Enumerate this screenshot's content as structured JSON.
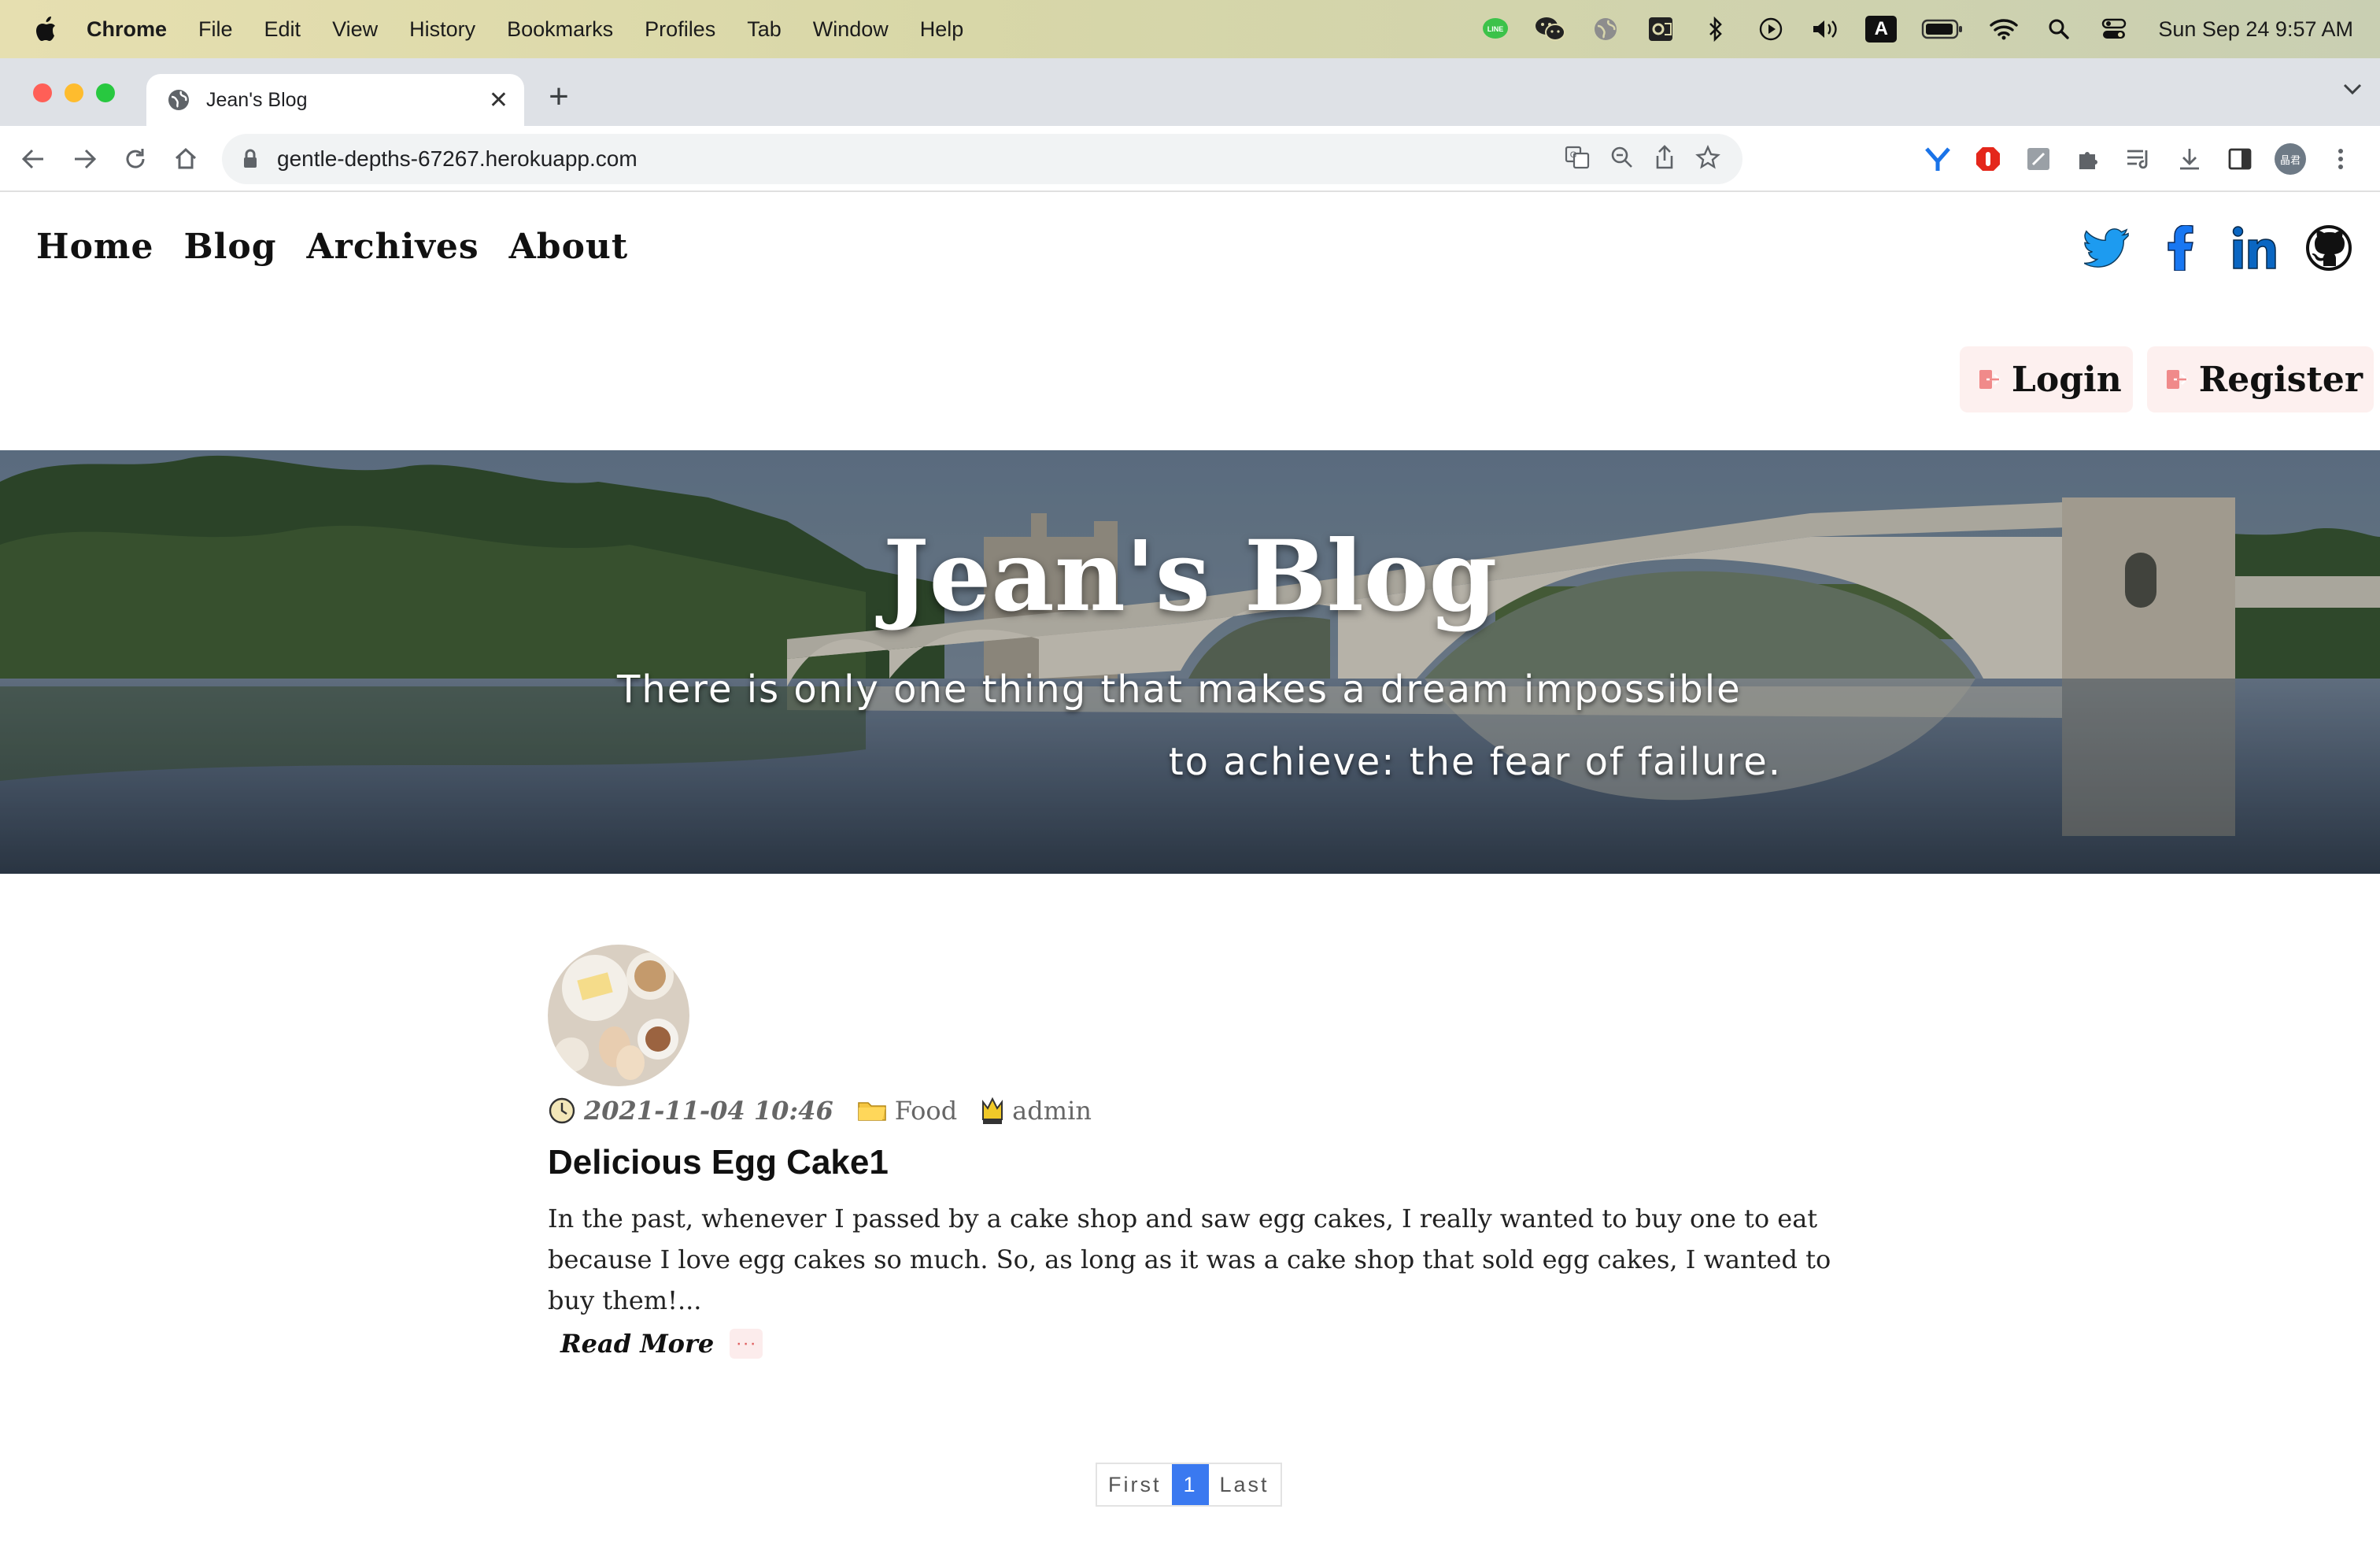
{
  "menubar": {
    "app": "Chrome",
    "items": [
      "File",
      "Edit",
      "View",
      "History",
      "Bookmarks",
      "Profiles",
      "Tab",
      "Window",
      "Help"
    ],
    "clock": "Sun Sep 24  9:57 AM",
    "status_icons": [
      "line-icon",
      "wechat-icon",
      "globe-icon",
      "outlook-icon",
      "bluetooth-icon",
      "play-icon",
      "volume-icon",
      "input-source-icon",
      "battery-icon",
      "wifi-icon",
      "spotlight-icon",
      "control-center-icon"
    ],
    "input_source": "A"
  },
  "browser": {
    "tab_title": "Jean's Blog",
    "url": "gentle-depths-67267.herokuapp.com",
    "profile_label": "晶君"
  },
  "site": {
    "nav": [
      "Home",
      "Blog",
      "Archives",
      "About"
    ],
    "social": [
      "twitter-icon",
      "facebook-icon",
      "linkedin-icon",
      "github-icon"
    ],
    "auth": {
      "login": "Login",
      "register": "Register"
    },
    "hero": {
      "title": "Jean's Blog",
      "subtitle_line1": "There is only one thing that makes a dream impossible",
      "subtitle_line2": "to achieve: the fear of failure."
    },
    "post": {
      "date": "2021-11-04 10:46",
      "category": "Food",
      "author": "admin",
      "title": "Delicious Egg Cake1",
      "excerpt": "In the past, whenever I passed by a cake shop and saw egg cakes, I really wanted to buy one to eat because I love egg cakes so much. So, as long as it was a cake shop that sold egg cakes, I wanted to buy them!...",
      "read_more": "Read More",
      "more_dots": "···"
    },
    "pager": {
      "first": "First",
      "current": "1",
      "last": "Last"
    }
  },
  "colors": {
    "accent": "#3a79f0",
    "auth_bg": "#fdf0ef",
    "twitter": "#1d9bf0"
  }
}
